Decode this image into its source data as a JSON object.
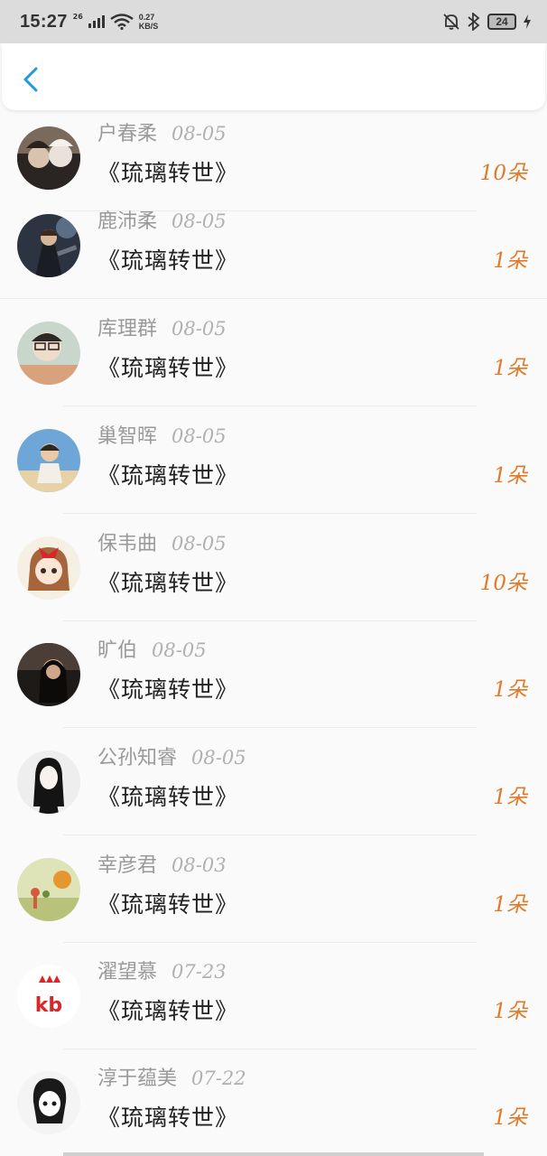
{
  "status_bar": {
    "time": "15:27",
    "network": "26",
    "speed_value": "0.27",
    "speed_unit": "KB/S",
    "battery": "24"
  },
  "nav": {
    "back_icon": "chevron-left-icon",
    "accent": "#1e9be0"
  },
  "colors": {
    "count": "#e07a28",
    "name": "#9a9a9a",
    "title": "#222222"
  },
  "list": [
    {
      "name": "户春柔",
      "date": "08-05",
      "title": "《琉璃转世》",
      "count": "10朵"
    },
    {
      "name": "鹿沛柔",
      "date": "08-05",
      "title": "《琉璃转世》",
      "count": "1朵"
    },
    {
      "name": "库理群",
      "date": "08-05",
      "title": "《琉璃转世》",
      "count": "1朵"
    },
    {
      "name": "巢智晖",
      "date": "08-05",
      "title": "《琉璃转世》",
      "count": "1朵"
    },
    {
      "name": "保韦曲",
      "date": "08-05",
      "title": "《琉璃转世》",
      "count": "10朵"
    },
    {
      "name": "旷伯",
      "date": "08-05",
      "title": "《琉璃转世》",
      "count": "1朵"
    },
    {
      "name": "公孙知睿",
      "date": "08-05",
      "title": "《琉璃转世》",
      "count": "1朵"
    },
    {
      "name": "幸彦君",
      "date": "08-03",
      "title": "《琉璃转世》",
      "count": "1朵"
    },
    {
      "name": "濯望慕",
      "date": "07-23",
      "title": "《琉璃转世》",
      "count": "1朵"
    },
    {
      "name": "淳于蕴美",
      "date": "07-22",
      "title": "《琉璃转世》",
      "count": "1朵"
    }
  ]
}
